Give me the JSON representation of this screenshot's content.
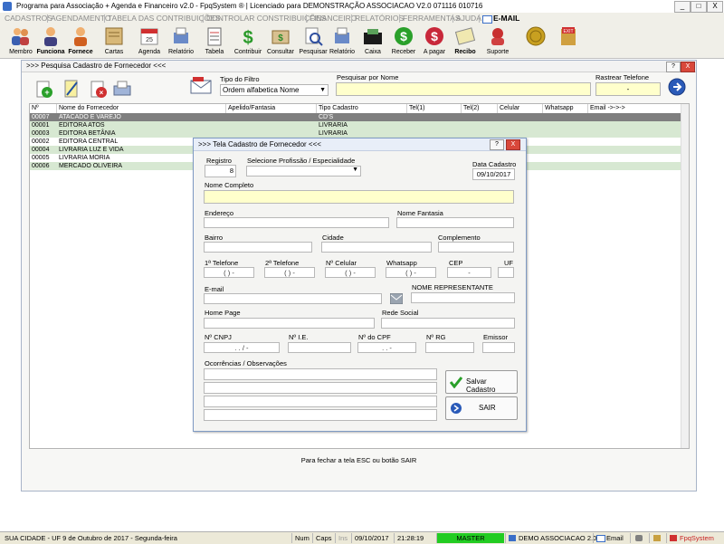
{
  "app_title": "Programa para Associação + Agenda e Financeiro v2.0 - FpqSystem ® | Licenciado para  DEMONSTRAÇÃO ASSOCIACAO V2.0 071116 010716",
  "window_controls": {
    "minimize": "_",
    "maximize": "□",
    "close": "X"
  },
  "menu": [
    "CADASTROS",
    "AGENDAMENTO",
    "TABELA DAS CONTRIBUIÇÕES",
    "CONTROLAR CONSTRIBUIÇÕES",
    "FINANCEIRO",
    "RELATÓRIOS",
    "FERRAMENTAS",
    "AJUDA",
    "E-MAIL"
  ],
  "toolbar": [
    {
      "label": "Membro",
      "icon": "members-icon"
    },
    {
      "label": "Funciona",
      "icon": "employee-icon"
    },
    {
      "label": "Fornece",
      "icon": "supplier-icon"
    },
    {
      "label": "Cartas",
      "icon": "letters-icon"
    },
    {
      "label": "Agenda",
      "icon": "calendar-icon"
    },
    {
      "label": "Relatório",
      "icon": "report-icon"
    },
    {
      "label": "Tabela",
      "icon": "table-icon"
    },
    {
      "label": "Contribuir",
      "icon": "contribute-icon"
    },
    {
      "label": "Consultar",
      "icon": "consult-icon"
    },
    {
      "label": "Pesquisar",
      "icon": "search-icon"
    },
    {
      "label": "Relatório",
      "icon": "report2-icon"
    },
    {
      "label": "Caixa",
      "icon": "cashbox-icon"
    },
    {
      "label": "Receber",
      "icon": "receive-icon"
    },
    {
      "label": "A pagar",
      "icon": "pay-icon"
    },
    {
      "label": "Recibo",
      "icon": "receipt-icon"
    },
    {
      "label": "Suporte",
      "icon": "support-icon"
    },
    {
      "label": "",
      "icon": "coins-icon"
    },
    {
      "label": "",
      "icon": "exit-icon"
    }
  ],
  "list_window": {
    "title": ">>> Pesquisa Cadastro de Fornecedor <<<",
    "help": "?",
    "close": "X",
    "filter_label": "Tipo do Filtro",
    "filter_value": "Ordem alfabetica Nome",
    "search_label": "Pesquisar por Nome",
    "search_value": "",
    "phone_label": "Rastrear Telefone",
    "phone_value": "-",
    "columns": [
      "Nº",
      "Nome do Fornecedor",
      "Apelido/Fantasia",
      "Tipo Cadastro",
      "Tel(1)",
      "Tel(2)",
      "Celular",
      "Whatsapp",
      "Email ->->->"
    ],
    "rows": [
      {
        "num": "00007",
        "name": "ATACADO E VAREJO",
        "nick": "",
        "type": "CD'S"
      },
      {
        "num": "00001",
        "name": "EDITORA ATOS",
        "nick": "",
        "type": "LIVRARIA"
      },
      {
        "num": "00003",
        "name": "EDITORA BETÂNIA",
        "nick": "",
        "type": "LIVRARIA"
      },
      {
        "num": "00002",
        "name": "EDITORA CENTRAL",
        "nick": "",
        "type": "LIVRARIA"
      },
      {
        "num": "00004",
        "name": "LIVRARIA LUZ E VIDA",
        "nick": "",
        "type": "LIVRARIA"
      },
      {
        "num": "00005",
        "name": "LIVRARIA MORIA",
        "nick": "",
        "type": "LIVRARIA"
      },
      {
        "num": "00006",
        "name": "MERCADO OLIVEIRA",
        "nick": "",
        "type": "LIVRARIA"
      }
    ],
    "footer_message": "Para fechar a tela ESC ou botão SAIR"
  },
  "dialog": {
    "title": ">>> Tela Cadastro de Fornecedor <<<",
    "help": "?",
    "close": "X",
    "registro_label": "Registro",
    "registro_value": "8",
    "profissao_label": "Selecione Profissão / Especialidade",
    "profissao_value": "",
    "data_label": "Data Cadastro",
    "data_value": "09/10/2017",
    "nome_label": "Nome Completo",
    "endereco_label": "Endereço",
    "fantasia_label": "Nome Fantasia",
    "bairro_label": "Bairro",
    "cidade_label": "Cidade",
    "complemento_label": "Complemento",
    "tel1_label": "1ª Telefone",
    "tel2_label": "2ª Telefone",
    "celular_label": "Nº Celular",
    "whatsapp_label": "Whatsapp",
    "cep_label": "CEP",
    "uf_label": "UF",
    "phone_mask": "(   )     -",
    "cep_mask": "-",
    "email_label": "E-mail",
    "representante_label": "NOME REPRESENTANTE",
    "homepage_label": "Home Page",
    "redesocial_label": "Rede Social",
    "cnpj_label": "Nº CNPJ",
    "cnpj_mask": ".     .     /     -",
    "ie_label": "Nº I.E.",
    "cpf_label": "Nº do CPF",
    "cpf_mask": ".     .     -",
    "rg_label": "Nº RG",
    "emissor_label": "Emissor",
    "obs_label": "Ocorrências / Observações",
    "save_label": "Salvar Cadastro",
    "exit_label": "SAIR"
  },
  "statusbar": {
    "city": "SUA CIDADE - UF  9 de Outubro de 2017 - Segunda-feira",
    "num": "Num",
    "caps": "Caps",
    "ins": "Ins",
    "date": "09/10/2017",
    "time": "21:28:19",
    "user": "MASTER",
    "company": "DEMO ASSOCIACAO 2.0",
    "email": "Email",
    "brand": "FpqSystem"
  },
  "colors": {
    "accent_green": "#22cc22",
    "selected_row": "#7f7f7f",
    "alt_row": "#d7e8d2",
    "input_yellow": "#ffffcc"
  }
}
